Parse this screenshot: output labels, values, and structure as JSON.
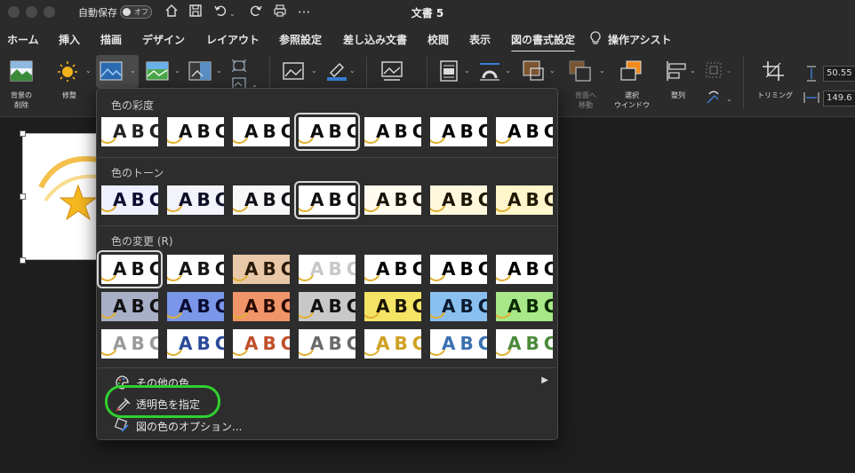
{
  "titlebar": {
    "autosave_label": "自動保存",
    "autosave_state": "オフ",
    "document_title": "文書 5",
    "quick_icons": [
      "home-icon",
      "save-icon",
      "undo-icon",
      "redo-icon",
      "print-icon",
      "more-icon"
    ]
  },
  "tabs": [
    {
      "label": "ホーム"
    },
    {
      "label": "挿入"
    },
    {
      "label": "描画"
    },
    {
      "label": "デザイン"
    },
    {
      "label": "レイアウト"
    },
    {
      "label": "参照設定"
    },
    {
      "label": "差し込み文書"
    },
    {
      "label": "校閲"
    },
    {
      "label": "表示"
    },
    {
      "label": "図の書式設定",
      "active": true
    },
    {
      "label": "操作アシスト"
    }
  ],
  "ribbon": {
    "remove_background": "背景の\n削除",
    "corrections": "修整",
    "send_backward": "背面へ\n移動",
    "selection_pane": "選択\nウインドウ",
    "align": "整列",
    "crop": "トリミング",
    "height_value": "50.55",
    "width_value": "149.6"
  },
  "color_menu": {
    "saturation_header": "色の彩度",
    "tone_header": "色のトーン",
    "recolor_header": "色の変更 (R)",
    "sample_text": "ABC",
    "saturation_selected_index": 3,
    "tone_selected_index": 3,
    "recolor_selected_index": 0,
    "saturation_colors": [
      "#222222",
      "#111111",
      "#101010",
      "#0d0d0d",
      "#0a0a0a",
      "#050505",
      "#000000"
    ],
    "tone_colors": [
      "#0a0a2e",
      "#0d0d26",
      "#101018",
      "#111111",
      "#181408",
      "#1c1604",
      "#201800"
    ],
    "recolor_rows": [
      [
        {
          "bg": "#ffffff",
          "fg": "#111111"
        },
        {
          "bg": "#ffffff",
          "fg": "#151515"
        },
        {
          "bg": "#e8c8a8",
          "fg": "#2a1a0a"
        },
        {
          "bg": "#ffffff",
          "fg": "#c8c8c8"
        },
        {
          "bg": "#ffffff",
          "fg": "#000000"
        },
        {
          "bg": "#ffffff",
          "fg": "#000000"
        },
        {
          "bg": "#ffffff",
          "fg": "#000000"
        }
      ],
      [
        {
          "bg": "#a8b0c8",
          "fg": "#111111"
        },
        {
          "bg": "#7a96e8",
          "fg": "#0a0a30"
        },
        {
          "bg": "#f0946a",
          "fg": "#2a0a00"
        },
        {
          "bg": "#c8c8c8",
          "fg": "#111111"
        },
        {
          "bg": "#f4e466",
          "fg": "#1a1400"
        },
        {
          "bg": "#8ac0f0",
          "fg": "#0a1a30"
        },
        {
          "bg": "#a8e888",
          "fg": "#0a2a00"
        }
      ],
      [
        {
          "bg": "#ffffff",
          "fg": "#9a9a9a"
        },
        {
          "bg": "#ffffff",
          "fg": "#2a4a9a"
        },
        {
          "bg": "#ffffff",
          "fg": "#c0502a"
        },
        {
          "bg": "#ffffff",
          "fg": "#6a6a6a"
        },
        {
          "bg": "#ffffff",
          "fg": "#d0a020"
        },
        {
          "bg": "#ffffff",
          "fg": "#3a70b0"
        },
        {
          "bg": "#ffffff",
          "fg": "#4a8a3a"
        }
      ]
    ],
    "more_colors": "その他の色",
    "set_transparent": "透明色を指定",
    "color_options": "図の色のオプション...",
    "submenu_arrow": "▶",
    "highlight_color": "#2fd02f"
  }
}
